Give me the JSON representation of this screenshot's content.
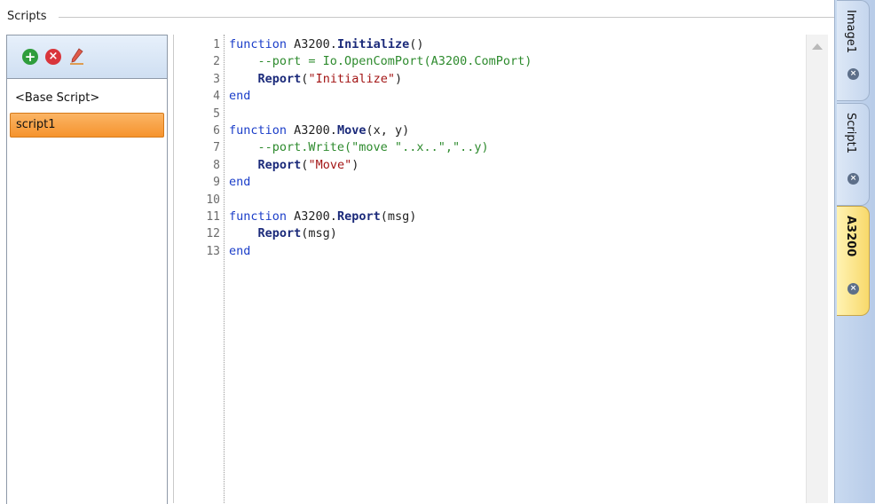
{
  "group": {
    "title": "Scripts"
  },
  "toolbar": {
    "add_icon": "plus-circle-icon",
    "delete_icon": "x-circle-icon",
    "edit_icon": "pencil-icon",
    "add_glyph": "+",
    "delete_glyph": "×"
  },
  "scripts": [
    {
      "label": "<Base Script>",
      "selected": false
    },
    {
      "label": "script1",
      "selected": true
    }
  ],
  "editor": {
    "lines": [
      {
        "n": "1",
        "parts": [
          {
            "t": "function",
            "c": "kw"
          },
          {
            "t": " A3200."
          },
          {
            "t": "Initialize",
            "c": "fn"
          },
          {
            "t": "()"
          }
        ]
      },
      {
        "n": "2",
        "parts": [
          {
            "t": "    --port = Io.OpenComPort(A3200.ComPort)",
            "c": "cm"
          }
        ]
      },
      {
        "n": "3",
        "parts": [
          {
            "t": "    "
          },
          {
            "t": "Report",
            "c": "fn"
          },
          {
            "t": "("
          },
          {
            "t": "\"Initialize\"",
            "c": "st"
          },
          {
            "t": ")"
          }
        ]
      },
      {
        "n": "4",
        "parts": [
          {
            "t": "end",
            "c": "kw"
          }
        ]
      },
      {
        "n": "5",
        "parts": []
      },
      {
        "n": "6",
        "parts": [
          {
            "t": "function",
            "c": "kw"
          },
          {
            "t": " A3200."
          },
          {
            "t": "Move",
            "c": "fn"
          },
          {
            "t": "(x, y)"
          }
        ]
      },
      {
        "n": "7",
        "parts": [
          {
            "t": "    --port.Write(\"move \"..x..\",\"..y)",
            "c": "cm"
          }
        ]
      },
      {
        "n": "8",
        "parts": [
          {
            "t": "    "
          },
          {
            "t": "Report",
            "c": "fn"
          },
          {
            "t": "("
          },
          {
            "t": "\"Move\"",
            "c": "st"
          },
          {
            "t": ")"
          }
        ]
      },
      {
        "n": "9",
        "parts": [
          {
            "t": "end",
            "c": "kw"
          }
        ]
      },
      {
        "n": "10",
        "parts": []
      },
      {
        "n": "11",
        "parts": [
          {
            "t": "function",
            "c": "kw"
          },
          {
            "t": " A3200."
          },
          {
            "t": "Report",
            "c": "fn"
          },
          {
            "t": "(msg)"
          }
        ]
      },
      {
        "n": "12",
        "parts": [
          {
            "t": "    "
          },
          {
            "t": "Report",
            "c": "fn"
          },
          {
            "t": "(msg)"
          }
        ]
      },
      {
        "n": "13",
        "parts": [
          {
            "t": "end",
            "c": "kw"
          }
        ]
      }
    ]
  },
  "tabs": [
    {
      "label": "Image1",
      "active": false,
      "close_icon": "close-circle-icon"
    },
    {
      "label": "Script1",
      "active": false,
      "close_icon": "close-circle-icon"
    },
    {
      "label": "A3200",
      "active": true,
      "close_icon": "close-circle-icon"
    }
  ]
}
